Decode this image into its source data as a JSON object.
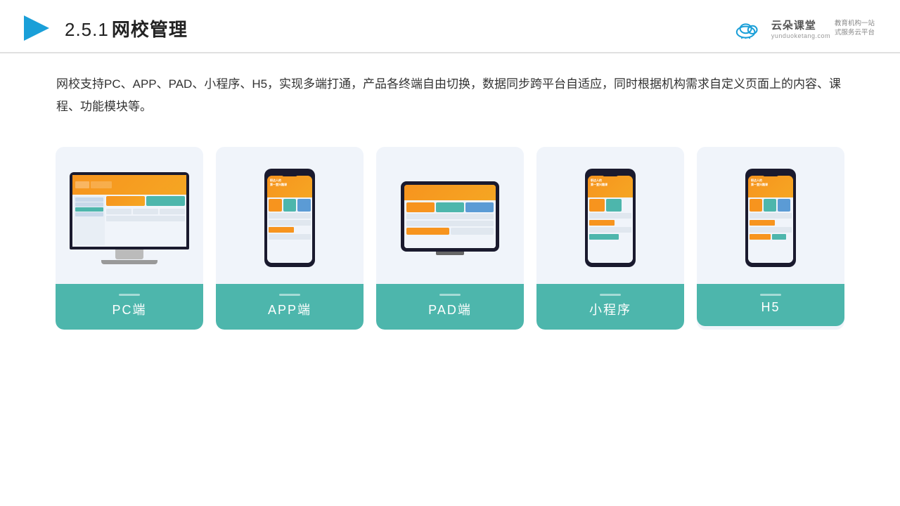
{
  "header": {
    "logo_alt": "blue arrow logo",
    "title_num": "2.5.1",
    "title_cn": "网校管理"
  },
  "brand": {
    "name_cn": "云朵课堂",
    "name_en": "yunduoketang.com",
    "slogan_line1": "教育机构一站",
    "slogan_line2": "式服务云平台"
  },
  "description": {
    "text": "网校支持PC、APP、PAD、小程序、H5，实现多端打通，产品各终端自由切换，数据同步跨平台自适应，同时根据机构需求自定义页面上的内容、课程、功能模块等。"
  },
  "cards": [
    {
      "label": "PC端",
      "type": "pc"
    },
    {
      "label": "APP端",
      "type": "phone"
    },
    {
      "label": "PAD端",
      "type": "tablet"
    },
    {
      "label": "小程序",
      "type": "phone2"
    },
    {
      "label": "H5",
      "type": "phone3"
    }
  ]
}
